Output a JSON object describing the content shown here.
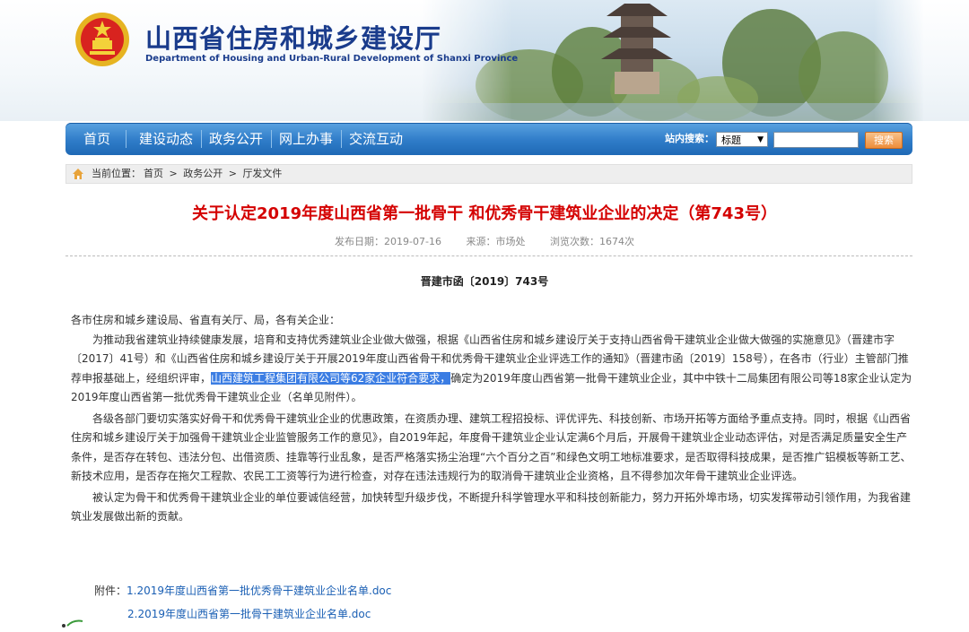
{
  "header": {
    "title": "山西省住房和城乡建设厅",
    "subtitle": "Department of Housing and Urban-Rural Development of Shanxi Province",
    "emblem_icon": "national-emblem-icon"
  },
  "nav": {
    "items": [
      "首页",
      "建设动态",
      "政务公开",
      "网上办事",
      "交流互动"
    ],
    "search_label": "站内搜索：",
    "select_value": "标题",
    "search_button": "搜索",
    "colors": {
      "bar": "#2f7cc8",
      "button": "#ee8d3b"
    }
  },
  "breadcrumb": {
    "prefix": "当前位置：",
    "items": [
      "首页",
      "政务公开",
      "厅发文件"
    ],
    "separator": ">"
  },
  "article": {
    "title": "关于认定2019年度山西省第一批骨干 和优秀骨干建筑业企业的决定（第743号）",
    "publish_date": "发布日期：2019-07-16",
    "source": "来源：市场处",
    "views": "浏览次数：1674次",
    "doc_number": "晋建市函〔2019〕743号",
    "salutation": "各市住房和城乡建设局、省直有关厅、局，各有关企业：",
    "p1_before": "为推动我省建筑业持续健康发展，培育和支持优秀建筑业企业做大做强，根据《山西省住房和城乡建设厅关于支持山西省骨干建筑业企业做大做强的实施意见》（晋建市字〔2017〕41号）和《山西省住房和城乡建设厅关于开展2019年度山西省骨干和优秀骨干建筑业企业评选工作的通知》（晋建市函〔2019〕158号），在各市（行业）主管部门推荐申报基础上，经组织评审，",
    "p1_highlight": "山西建筑工程集团有限公司等62家企业符合要求，",
    "p1_after": "确定为2019年度山西省第一批骨干建筑业企业，其中中铁十二局集团有限公司等18家企业认定为2019年度山西省第一批优秀骨干建筑业企业（名单见附件）。",
    "p2": "各级各部门要切实落实好骨干和优秀骨干建筑业企业的优惠政策，在资质办理、建筑工程招投标、评优评先、科技创新、市场开拓等方面给予重点支持。同时，根据《山西省住房和城乡建设厅关于加强骨干建筑业企业监管服务工作的意见》，自2019年起，年度骨干建筑业企业认定满6个月后，开展骨干建筑业企业动态评估，对是否满足质量安全生产条件，是否存在转包、违法分包、出借资质、挂靠等行业乱象，是否严格落实扬尘治理“六个百分之百”和绿色文明工地标准要求，是否取得科技成果，是否推广铝模板等新工艺、新技术应用，是否存在拖欠工程款、农民工工资等行为进行检查，对存在违法违规行为的取消骨干建筑业企业资格，且不得参加次年骨干建筑业企业评选。",
    "p3": "被认定为骨干和优秀骨干建筑业企业的单位要诚信经营，加快转型升级步伐，不断提升科学管理水平和科技创新能力，努力开拓外埠市场，切实发挥带动引领作用，为我省建筑业发展做出新的贡献。",
    "highlight_color": "#3b7de3"
  },
  "attachments": {
    "label": "附件：",
    "items": [
      "1.2019年度山西省第一批优秀骨干建筑业企业名单.doc",
      "2.2019年度山西省第一批骨干建筑业企业名单.doc"
    ]
  }
}
